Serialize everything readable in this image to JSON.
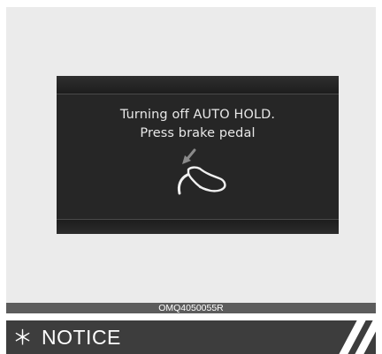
{
  "display": {
    "line1": "Turning off AUTO HOLD.",
    "line2": "Press brake pedal",
    "icon": "brake-pedal-foot-icon"
  },
  "caption": {
    "code": "OMQ4050055R"
  },
  "notice": {
    "symbol": "＊",
    "title": "NOTICE"
  },
  "colors": {
    "display_background": "#262626",
    "display_text": "#e8e8e8",
    "panel_background": "#ebebeb",
    "caption_bar": "#5c5c5c",
    "notice_bar": "#3d3d3d"
  }
}
